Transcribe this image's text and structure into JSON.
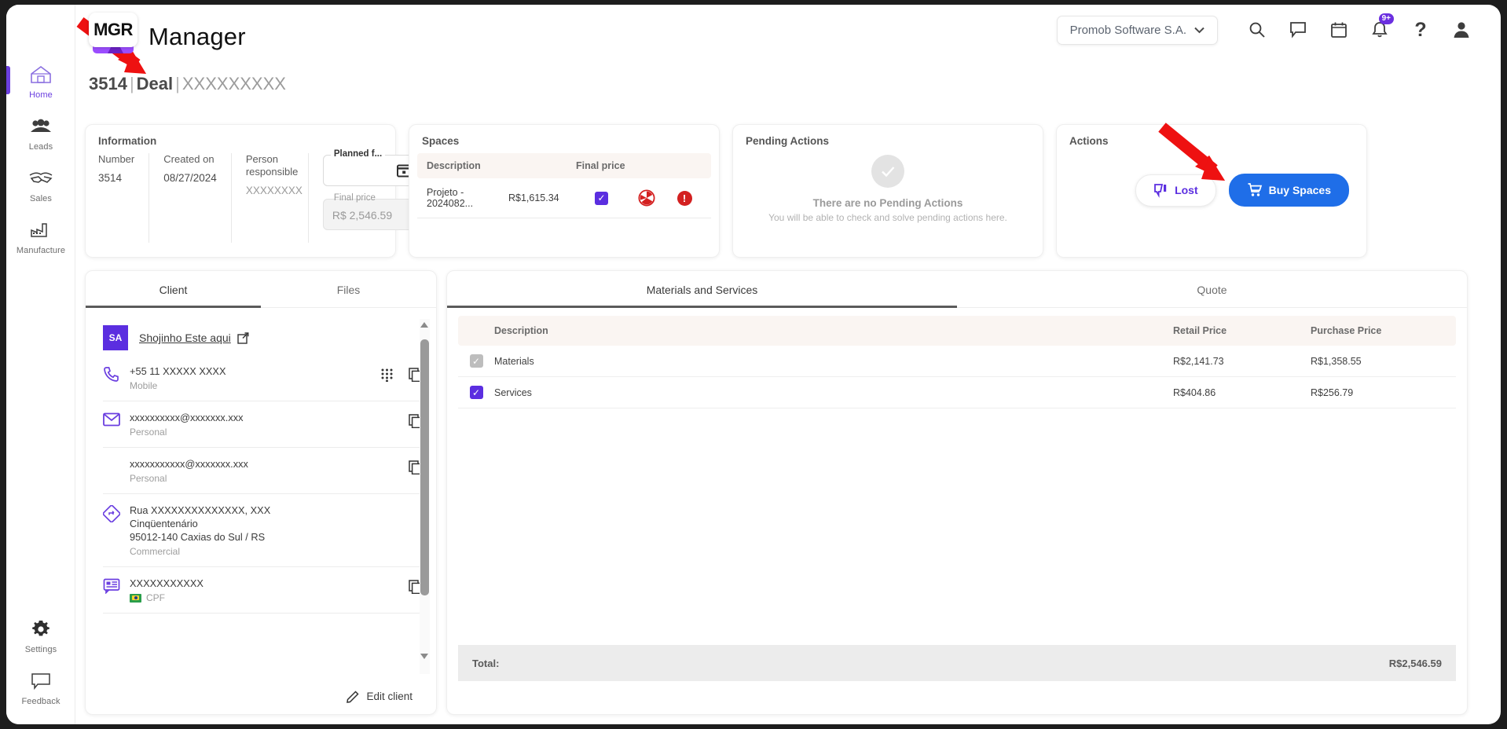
{
  "brand": {
    "logo_text": "MGR",
    "app_title": "Manager"
  },
  "page": {
    "deal_number": "3514",
    "sep1": "|",
    "deal_word": "Deal",
    "sep2": "|",
    "deal_name": "XXXXXXXXX"
  },
  "header": {
    "org": "Promob Software S.A.",
    "chevron": "⌄",
    "icons": [
      {
        "name": "search-icon",
        "glyph": "search"
      },
      {
        "name": "chat-icon",
        "glyph": "chat"
      },
      {
        "name": "calendar-icon",
        "glyph": "calendar"
      },
      {
        "name": "notifications-icon",
        "glyph": "bell",
        "badge": "9+"
      },
      {
        "name": "help-icon",
        "glyph": "?"
      },
      {
        "name": "account-icon",
        "glyph": "person"
      }
    ],
    "badge_color": "#6b2fe0"
  },
  "sidebar": {
    "active": "Home",
    "accent": "#6b3fe0",
    "items": [
      {
        "label": "Home",
        "icon": "home-icon"
      },
      {
        "label": "Leads",
        "icon": "people-icon"
      },
      {
        "label": "Sales",
        "icon": "handshake-icon"
      },
      {
        "label": "Manufacture",
        "icon": "factory-icon"
      }
    ],
    "bottom_items": [
      {
        "label": "Settings",
        "icon": "gear-icon"
      },
      {
        "label": "Feedback",
        "icon": "speech-bubble-icon"
      }
    ]
  },
  "information": {
    "title": "Information",
    "number_label": "Number",
    "number_value": "3514",
    "created_label": "Created on",
    "created_value": "08/27/2024",
    "person_label": "Person responsible",
    "person_value": "XXXXXXXX",
    "planned_label": "Planned f...",
    "planned_value": "",
    "final_price_label": "Final price",
    "final_price_value": "R$ 2,546.59"
  },
  "spaces": {
    "title": "Spaces",
    "columns": [
      "Description",
      "Final price"
    ],
    "rows": [
      {
        "description": "Projeto - 2024082...",
        "final_price": "R$1,615.34",
        "checked": true,
        "status_icon": "red-pie-icon",
        "alert_icon": "error-alert-icon",
        "alert_glyph": "!"
      }
    ]
  },
  "pending_actions": {
    "title": "Pending Actions",
    "check_glyph": "✓",
    "empty_title": "There are no Pending Actions",
    "empty_subtitle": "You will be able to check and solve pending actions here."
  },
  "actions": {
    "title": "Actions",
    "lost_label": "Lost",
    "lost_icon": "thumbs-down-icon",
    "buy_label": "Buy Spaces",
    "buy_icon": "shopping-cart-icon",
    "buy_color": "#1f6ee8",
    "lost_color": "#5b2ee0"
  },
  "client_panel": {
    "tabs": [
      {
        "label": "Client",
        "active": true
      },
      {
        "label": "Files",
        "active": false
      }
    ],
    "avatar_initials": "SA",
    "client_name": "Shojinho Este aqui",
    "external_link_icon": "external-link-icon",
    "contacts": [
      {
        "icon": "phone-icon",
        "value": "+55 11  XXXXX XXXX",
        "subtitle": "Mobile",
        "actions": [
          "dialpad-icon",
          "copy-icon"
        ]
      },
      {
        "icon": "email-icon",
        "value": "xxxxxxxxxx@xxxxxxx.xxx",
        "subtitle": "Personal",
        "actions": [
          "copy-icon"
        ]
      },
      {
        "icon": "",
        "value": "xxxxxxxxxxx@xxxxxxx.xxx",
        "subtitle": "Personal",
        "actions": [
          "copy-icon"
        ]
      }
    ],
    "address": {
      "icon": "location-icon",
      "line1": "Rua XXXXXXXXXXXXXX, XXX",
      "line2": "Cinqüentenário",
      "line3": "95012-140 Caxias do Sul / RS",
      "subtitle": "Commercial"
    },
    "document": {
      "icon": "document-icon",
      "value": "XXXXXXXXXXX",
      "subtitle": "CPF",
      "flag": "br-flag-icon",
      "actions": [
        "copy-icon"
      ]
    },
    "edit_label": "Edit client",
    "edit_icon": "pencil-icon"
  },
  "materials_panel": {
    "tabs": [
      {
        "label": "Materials and Services",
        "active": true
      },
      {
        "label": "Quote",
        "active": false
      }
    ],
    "columns": [
      "Description",
      "Retail Price",
      "Purchase Price"
    ],
    "rows": [
      {
        "checked": true,
        "enabled": false,
        "description": "Materials",
        "retail_price": "R$2,141.73",
        "purchase_price": "R$1,358.55"
      },
      {
        "checked": true,
        "enabled": true,
        "description": "Services",
        "retail_price": "R$404.86",
        "purchase_price": "R$256.79"
      }
    ],
    "total_label": "Total:",
    "total_value": "R$2,546.59"
  },
  "annotations": {
    "arrow_color": "#ee1111",
    "arrows": [
      "arrow-pointing-to-deal-title",
      "arrow-pointing-to-buy-spaces"
    ]
  }
}
